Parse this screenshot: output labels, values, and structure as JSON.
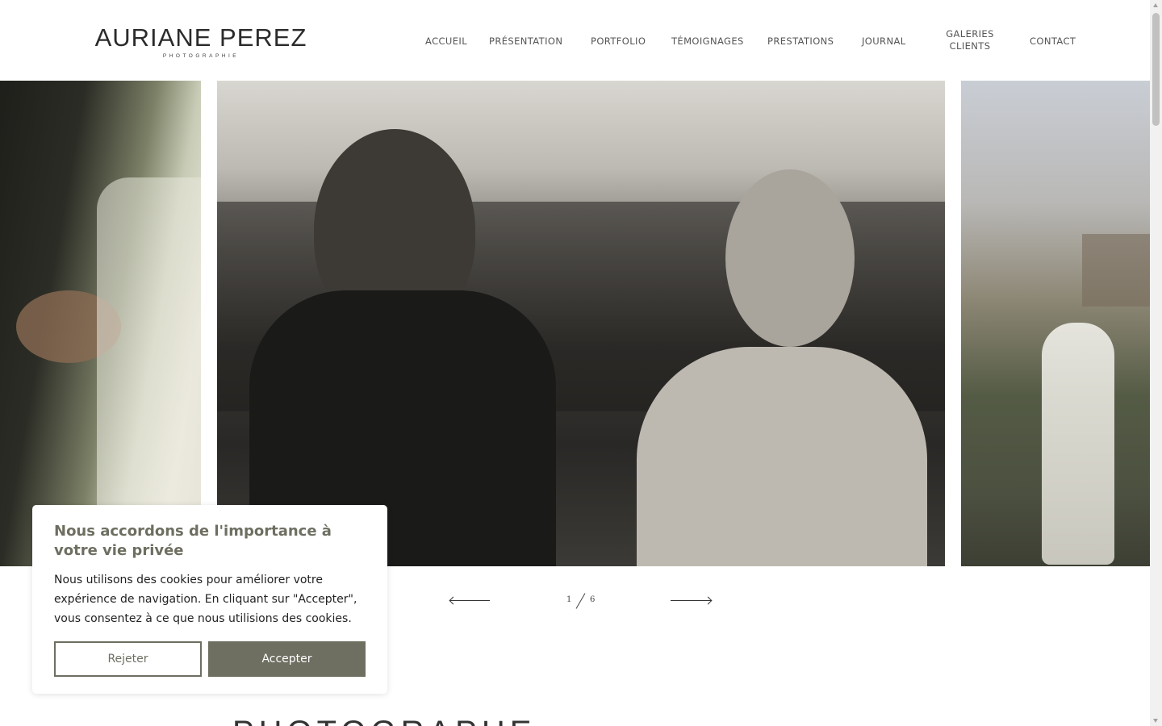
{
  "brand": {
    "name": "AURIANE PEREZ",
    "tagline": "PHOTOGRAPHIE"
  },
  "nav": {
    "items": [
      {
        "label": "ACCUEIL"
      },
      {
        "label": "PRÉSENTATION"
      },
      {
        "label": "PORTFOLIO"
      },
      {
        "label": "TÉMOIGNAGES"
      },
      {
        "label": "PRESTATIONS"
      },
      {
        "label": "JOURNAL"
      },
      {
        "label": "GALERIES CLIENTS"
      },
      {
        "label": "CONTACT"
      }
    ]
  },
  "slider": {
    "current": "1",
    "total": "6",
    "prev_icon": "arrow-left-icon",
    "next_icon": "arrow-right-icon"
  },
  "section": {
    "heading": "PHOTOGRAPHE"
  },
  "cookie_banner": {
    "title": "Nous accordons de l'importance à votre vie privée",
    "text": "Nous utilisons des cookies pour améliorer votre expérience de navigation. En cliquant sur \"Accepter\", vous consentez à ce que nous utilisions des cookies.",
    "reject_label": "Rejeter",
    "accept_label": "Accepter"
  },
  "colors": {
    "accent": "#6e6f61",
    "nav_text": "#555555",
    "background": "#ffffff"
  }
}
